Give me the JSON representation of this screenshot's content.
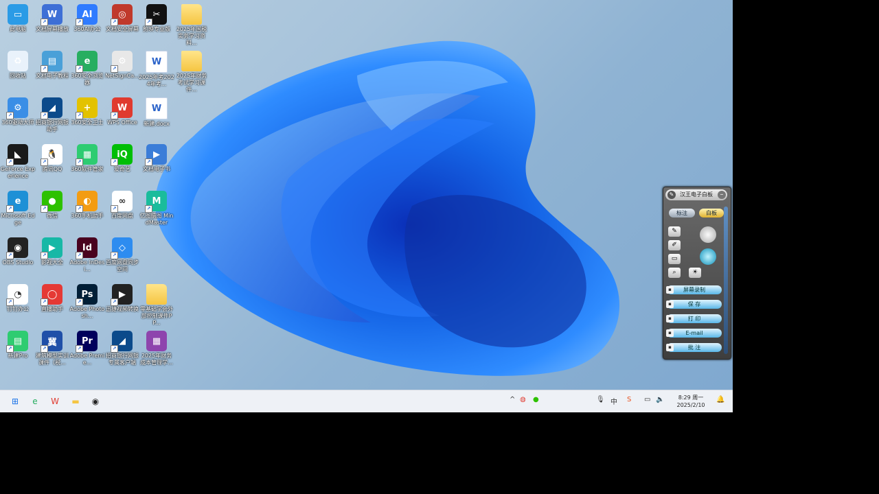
{
  "desktop": {
    "icons": [
      {
        "label": "此电脑",
        "icon": "computer-icon",
        "color": "#2b9be6",
        "glyph": "▭",
        "shortcut": false
      },
      {
        "label": "文档屏幕播放",
        "icon": "screen-player-icon",
        "color": "#3d6fd6",
        "glyph": "W",
        "shortcut": true
      },
      {
        "label": "360AI办公",
        "icon": "ai-icon",
        "color": "#2f7bff",
        "glyph": "AI",
        "shortcut": true
      },
      {
        "label": "文档安全屏幕",
        "icon": "security-screen-icon",
        "color": "#c0392b",
        "glyph": "◎",
        "shortcut": true
      },
      {
        "label": "剪映专业版",
        "icon": "capcut-icon",
        "color": "#111111",
        "glyph": "✂",
        "shortcut": true
      },
      {
        "label": "2025年国税实务学习资料...",
        "icon": "folder-icon",
        "color": "#f5c542",
        "glyph": "",
        "shortcut": false
      },
      {
        "label": "回收站",
        "icon": "recycle-bin-icon",
        "color": "#e9f2fb",
        "glyph": "♻",
        "shortcut": false
      },
      {
        "label": "文档电子教程",
        "icon": "tutorial-icon",
        "color": "#4aa0d8",
        "glyph": "▤",
        "shortcut": true
      },
      {
        "label": "360安全浏览器",
        "icon": "browser-360-icon",
        "color": "#27ae60",
        "glyph": "e",
        "shortcut": true
      },
      {
        "label": "NetSignCa...",
        "icon": "netsign-icon",
        "color": "#e8e8e8",
        "glyph": "⚙",
        "shortcut": true
      },
      {
        "label": "2025年考2024年考...",
        "icon": "word-doc-icon",
        "color": "#ffffff",
        "glyph": "W",
        "shortcut": false
      },
      {
        "label": "2025年财务考试学习课件...",
        "icon": "folder-icon",
        "color": "#f5c542",
        "glyph": "",
        "shortcut": false
      },
      {
        "label": "360驱动大师",
        "icon": "driver-master-icon",
        "color": "#3a8ee6",
        "glyph": "⚙",
        "shortcut": true
      },
      {
        "label": "招商银行网银助手",
        "icon": "bank-icon",
        "color": "#0b4a8b",
        "glyph": "◢",
        "shortcut": true
      },
      {
        "label": "360安全卫士",
        "icon": "security-guard-icon",
        "color": "#e3c200",
        "glyph": "+",
        "shortcut": true
      },
      {
        "label": "WPS Office",
        "icon": "wps-icon",
        "color": "#e03a2f",
        "glyph": "W",
        "shortcut": true
      },
      {
        "label": "新建.docx",
        "icon": "word-doc-icon",
        "color": "#ffffff",
        "glyph": "W",
        "shortcut": false
      },
      {
        "label": "",
        "icon": "blank",
        "color": "transparent",
        "glyph": "",
        "shortcut": false
      },
      {
        "label": "GeForce Experience",
        "icon": "nvidia-icon",
        "color": "#1a1a1a",
        "glyph": "◣",
        "shortcut": true
      },
      {
        "label": "腾讯QQ",
        "icon": "qq-icon",
        "color": "#ffffff",
        "glyph": "🐧",
        "shortcut": true
      },
      {
        "label": "360软件管家",
        "icon": "software-manager-icon",
        "color": "#2ecc71",
        "glyph": "▦",
        "shortcut": true
      },
      {
        "label": "爱奇艺",
        "icon": "iqiyi-icon",
        "color": "#00be06",
        "glyph": "iQ",
        "shortcut": true
      },
      {
        "label": "文档电子书",
        "icon": "ebook-icon",
        "color": "#3b7dd8",
        "glyph": "▶",
        "shortcut": true
      },
      {
        "label": "",
        "icon": "blank",
        "color": "transparent",
        "glyph": "",
        "shortcut": false
      },
      {
        "label": "Microsoft Edge",
        "icon": "edge-icon",
        "color": "#1e90d6",
        "glyph": "e",
        "shortcut": true
      },
      {
        "label": "微信",
        "icon": "wechat-icon",
        "color": "#2dc100",
        "glyph": "●",
        "shortcut": true
      },
      {
        "label": "360手机助手",
        "icon": "phone-assistant-icon",
        "color": "#f39c12",
        "glyph": "◐",
        "shortcut": true
      },
      {
        "label": "百度网盘",
        "icon": "baidu-netdisk-icon",
        "color": "#ffffff",
        "glyph": "∞",
        "shortcut": true
      },
      {
        "label": "亿图脑图 MindMaster",
        "icon": "mindmaster-icon",
        "color": "#1abc9c",
        "glyph": "M",
        "shortcut": true
      },
      {
        "label": "",
        "icon": "blank",
        "color": "transparent",
        "glyph": "",
        "shortcut": false
      },
      {
        "label": "OBS Studio",
        "icon": "obs-icon",
        "color": "#222222",
        "glyph": "◉",
        "shortcut": true
      },
      {
        "label": "影视大全",
        "icon": "video-app-icon",
        "color": "#17b8a6",
        "glyph": "▶",
        "shortcut": true
      },
      {
        "label": "Adobe InDesi...",
        "icon": "indesign-icon",
        "color": "#49021f",
        "glyph": "Id",
        "shortcut": true
      },
      {
        "label": "百度网盘同步空间",
        "icon": "sync-icon",
        "color": "#2d8cf0",
        "glyph": "◇",
        "shortcut": true
      },
      {
        "label": "",
        "icon": "blank",
        "color": "transparent",
        "glyph": "",
        "shortcut": false
      },
      {
        "label": "",
        "icon": "blank",
        "color": "transparent",
        "glyph": "",
        "shortcut": false
      },
      {
        "label": "钉钉办公",
        "icon": "dingtalk-icon",
        "color": "#ffffff",
        "glyph": "◔",
        "shortcut": true
      },
      {
        "label": "直播助手",
        "icon": "live-icon",
        "color": "#e53935",
        "glyph": "◯",
        "shortcut": true
      },
      {
        "label": "Adobe Photosh...",
        "icon": "photoshop-icon",
        "color": "#001e36",
        "glyph": "Ps",
        "shortcut": true
      },
      {
        "label": "迅捷视频转换",
        "icon": "video-convert-icon",
        "color": "#222222",
        "glyph": "▶",
        "shortcut": true
      },
      {
        "label": "零基础学会外部控制课件PP...",
        "icon": "folder-icon",
        "color": "#f5c542",
        "glyph": "",
        "shortcut": false
      },
      {
        "label": "",
        "icon": "blank",
        "color": "transparent",
        "glyph": "",
        "shortcut": false
      },
      {
        "label": "新建Pro",
        "icon": "new-pro-icon",
        "color": "#2ecc71",
        "glyph": "▤",
        "shortcut": true
      },
      {
        "label": "建筑模型实训课件（税...",
        "icon": "training-icon",
        "color": "#1f4fa8",
        "glyph": "冀",
        "shortcut": true
      },
      {
        "label": "Adobe Premie...",
        "icon": "premiere-icon",
        "color": "#00005b",
        "glyph": "Pr",
        "shortcut": true
      },
      {
        "label": "招商银行网银专属客户端",
        "icon": "bank-client-icon",
        "color": "#0b4a8b",
        "glyph": "◢",
        "shortcut": true
      },
      {
        "label": "2025年财务成本管理学...",
        "icon": "rar-icon",
        "color": "#8e44ad",
        "glyph": "▦",
        "shortcut": false
      }
    ]
  },
  "taskbar": {
    "apps": [
      {
        "name": "start-icon",
        "glyph": "⊞",
        "color": "#1a73e8"
      },
      {
        "name": "browser-360-icon",
        "glyph": "e",
        "color": "#27ae60"
      },
      {
        "name": "wps-icon",
        "glyph": "W",
        "color": "#e03a2f"
      },
      {
        "name": "file-explorer-icon",
        "glyph": "▬",
        "color": "#f5c542"
      },
      {
        "name": "obs-icon",
        "glyph": "◉",
        "color": "#222222"
      }
    ],
    "tray": {
      "chevron": "^",
      "time": "8:29 周一",
      "date": "2025/2/10"
    }
  },
  "pen_panel": {
    "title": "汉王电子白板",
    "mode_buttons": [
      "标注",
      "白板"
    ],
    "actions": [
      {
        "label": "屏幕录制",
        "icon": "record-icon"
      },
      {
        "label": "保 存",
        "icon": "save-icon"
      },
      {
        "label": "打 印",
        "icon": "print-icon"
      },
      {
        "label": "E-mail",
        "icon": "email-icon"
      },
      {
        "label": "批 注",
        "icon": "annotate-icon"
      }
    ],
    "accent": "#59b7e8"
  }
}
